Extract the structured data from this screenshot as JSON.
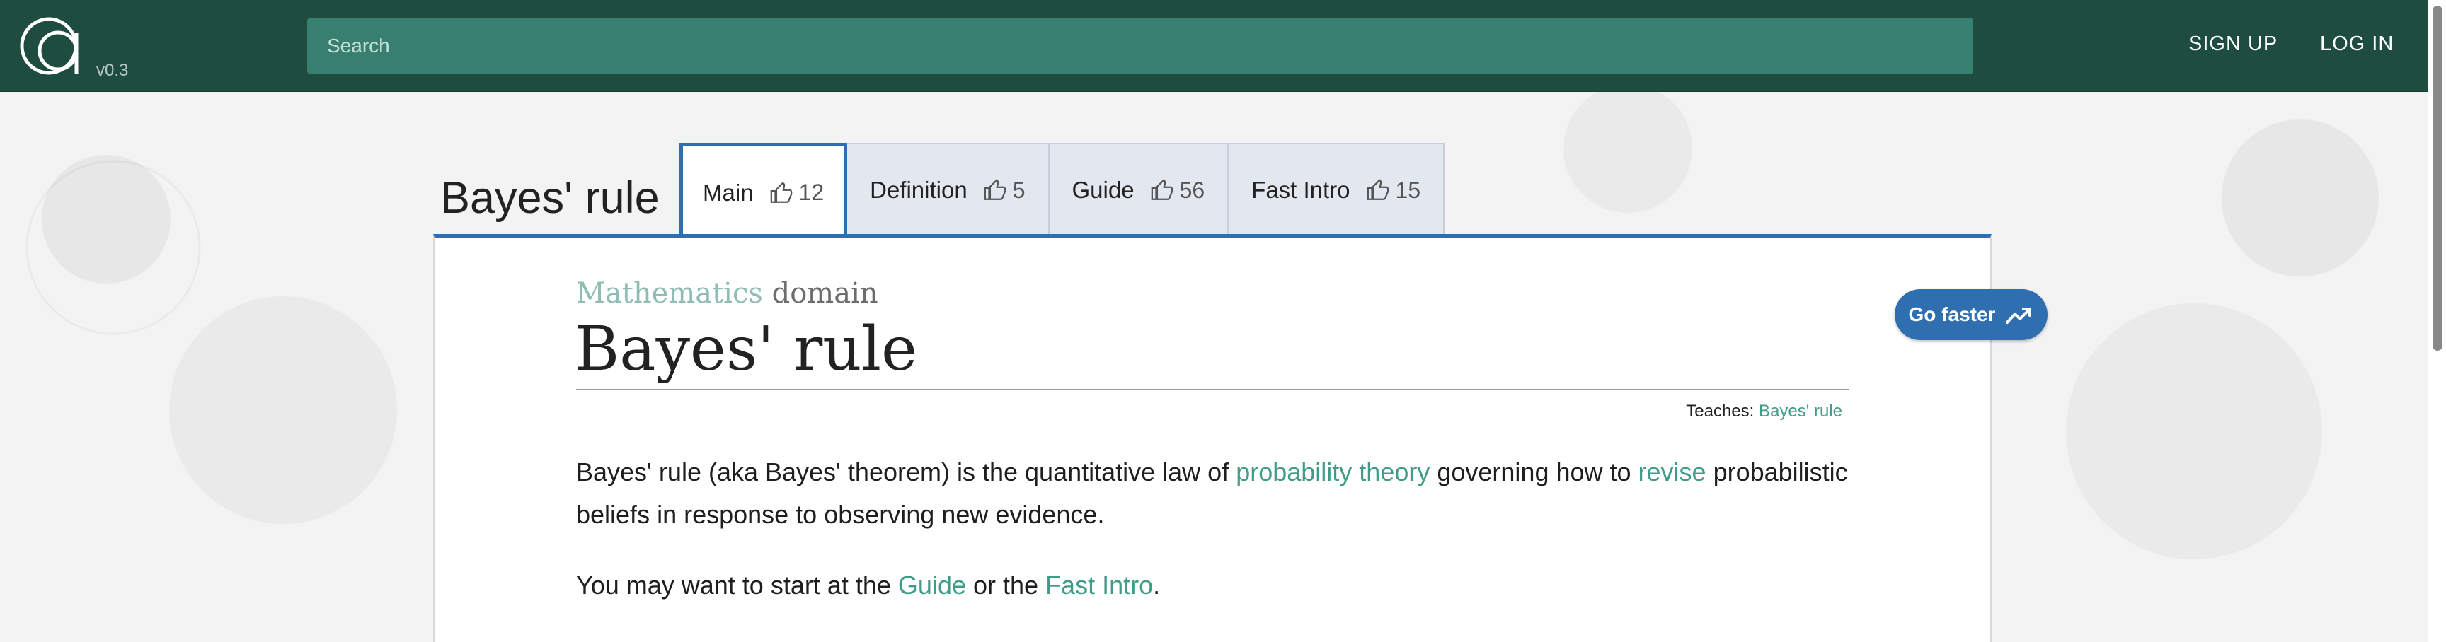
{
  "header": {
    "version": "v0.3",
    "search_placeholder": "Search",
    "sign_up": "SIGN UP",
    "log_in": "LOG IN"
  },
  "page": {
    "title": "Bayes' rule"
  },
  "tabs": [
    {
      "label": "Main",
      "likes": "12",
      "active": true
    },
    {
      "label": "Definition",
      "likes": "5",
      "active": false
    },
    {
      "label": "Guide",
      "likes": "56",
      "active": false
    },
    {
      "label": "Fast Intro",
      "likes": "15",
      "active": false
    }
  ],
  "article": {
    "domain_name": "Mathematics",
    "domain_word": "domain",
    "title": "Bayes' rule",
    "teaches_label": "Teaches:",
    "teaches_link": "Bayes' rule",
    "para1": {
      "t1": "Bayes' rule (aka Bayes' theorem) is the quantitative law of ",
      "link1": "probability theory",
      "t2": " governing how to ",
      "link2": "revise",
      "t3": " probabilistic beliefs in response to observing new evidence."
    },
    "para2": {
      "t1": "You may want to start at the ",
      "link1": "Guide",
      "t2": " or the ",
      "link2": "Fast Intro",
      "t3": "."
    }
  },
  "go_faster": {
    "label": "Go faster",
    "icon": "trending-up-icon"
  },
  "colors": {
    "header_bg": "#1e4d40",
    "search_bg": "#37806f",
    "accent_blue": "#2f6fb0",
    "link_green": "#3f9c88"
  }
}
